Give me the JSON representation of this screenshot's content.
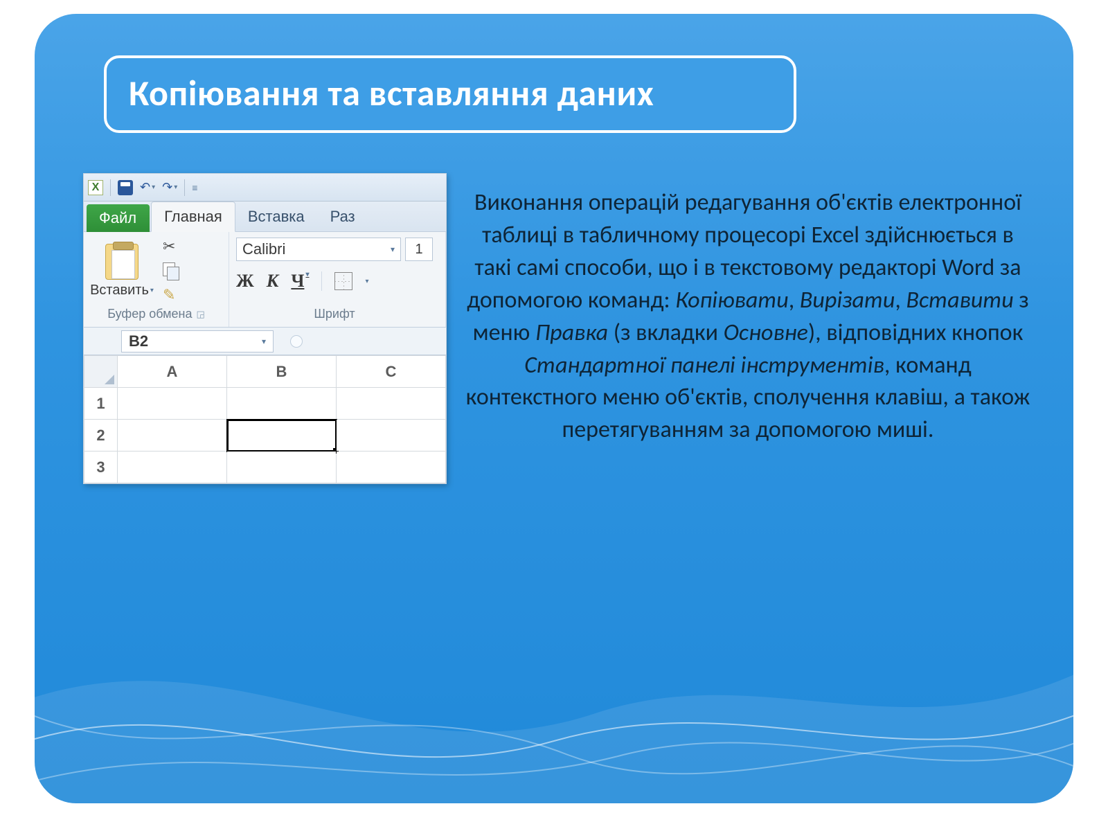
{
  "title": "Копіювання та вставляння даних",
  "body_html": "Виконання операцій редагування об'єктів електронної таблиці в табличному процесорі Excel здійснюється в такі самі способи, що і в текстовому редакторі Word за допомогою команд: <em>Копіювати</em>, <em>Вирізати</em>, <em>Вставити</em> з меню <em>Правка</em> (з вкладки <em>Основне</em>), відповідних кнопок <em>Стандартної панелі інструментів</em>, команд контекстного меню об'єктів, сполучення клавіш, а також перетягуванням за допомогою миші.",
  "excel": {
    "tabs": {
      "file": "Файл",
      "home": "Главная",
      "insert": "Вставка",
      "layout": "Раз"
    },
    "clipboard": {
      "paste": "Вставить",
      "group": "Буфер обмена"
    },
    "font": {
      "name": "Calibri",
      "size": "1",
      "bold": "Ж",
      "italic": "К",
      "underline": "Ч",
      "group": "Шрифт"
    },
    "namebox": "B2",
    "cols": [
      "A",
      "B",
      "C"
    ],
    "rows": [
      "1",
      "2",
      "3"
    ]
  }
}
